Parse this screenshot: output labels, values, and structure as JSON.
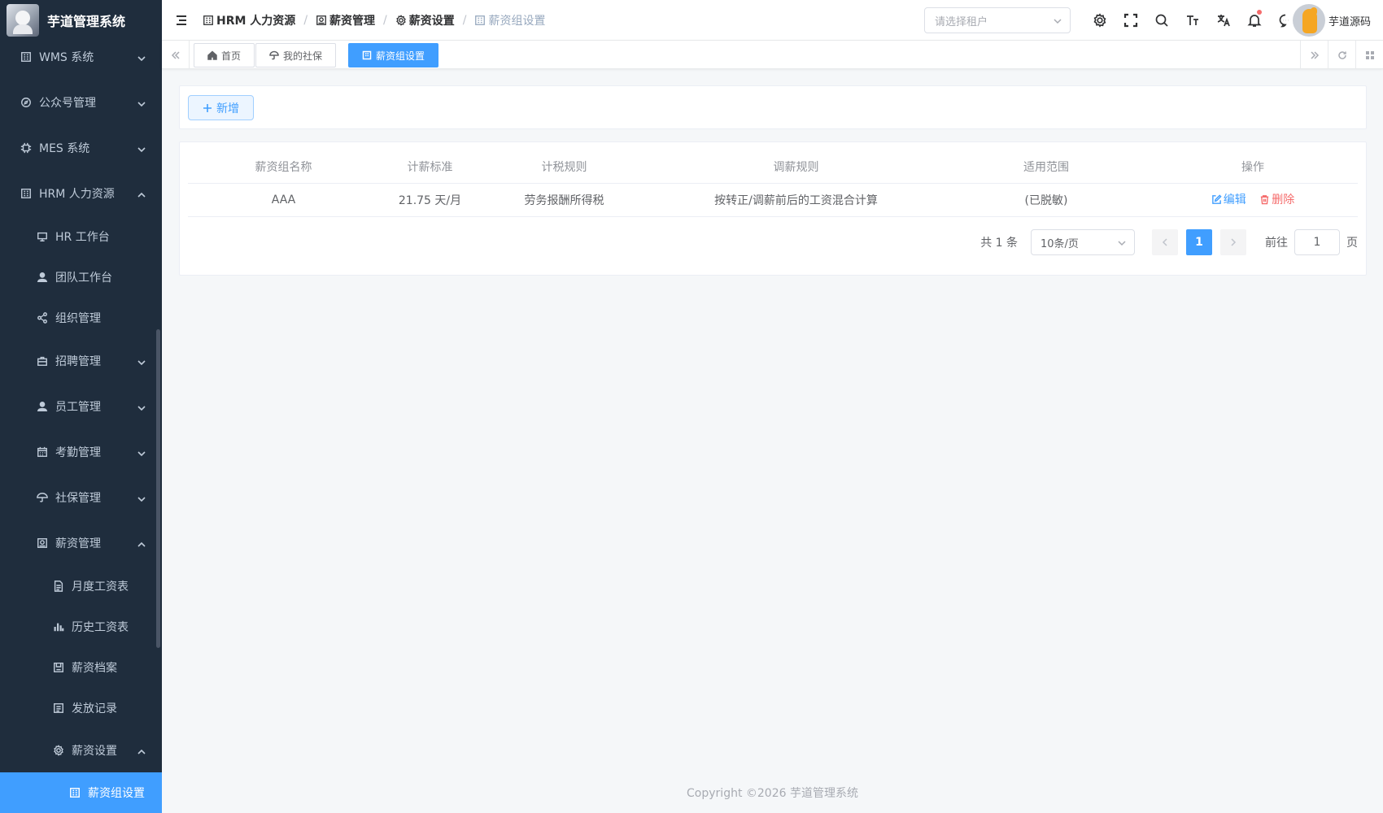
{
  "app": {
    "title": "芋道管理系统"
  },
  "sidebar": {
    "items": [
      {
        "label": "WMS 系统",
        "icon": "building-icon",
        "level": 1,
        "arrow": "down"
      },
      {
        "label": "公众号管理",
        "icon": "compass-icon",
        "level": 1,
        "arrow": "down"
      },
      {
        "label": "MES 系统",
        "icon": "cpu-icon",
        "level": 1,
        "arrow": "down"
      },
      {
        "label": "HRM 人力资源",
        "icon": "building-icon",
        "level": 1,
        "arrow": "up"
      },
      {
        "label": "HR 工作台",
        "icon": "monitor-icon",
        "level": 2
      },
      {
        "label": "团队工作台",
        "icon": "user-icon",
        "level": 2
      },
      {
        "label": "组织管理",
        "icon": "share-icon",
        "level": 2
      },
      {
        "label": "招聘管理",
        "icon": "briefcase-icon",
        "level": 2,
        "arrow": "down"
      },
      {
        "label": "员工管理",
        "icon": "user-icon",
        "level": 2,
        "arrow": "down"
      },
      {
        "label": "考勤管理",
        "icon": "calendar-icon",
        "level": 2,
        "arrow": "down"
      },
      {
        "label": "社保管理",
        "icon": "umbrella-icon",
        "level": 2,
        "arrow": "down"
      },
      {
        "label": "薪资管理",
        "icon": "money-icon",
        "level": 2,
        "arrow": "up"
      },
      {
        "label": "月度工资表",
        "icon": "document-icon",
        "level": 3
      },
      {
        "label": "历史工资表",
        "icon": "bar-chart-icon",
        "level": 3
      },
      {
        "label": "薪资档案",
        "icon": "archive-icon",
        "level": 3
      },
      {
        "label": "发放记录",
        "icon": "list-icon",
        "level": 3
      },
      {
        "label": "薪资设置",
        "icon": "gear-icon",
        "level": 3,
        "arrow": "up"
      },
      {
        "label": "薪资组设置",
        "icon": "building-icon",
        "level": 4,
        "active": true
      }
    ]
  },
  "header": {
    "breadcrumb": [
      "HRM 人力资源",
      "薪资管理",
      "薪资设置",
      "薪资组设置"
    ],
    "tenant_placeholder": "请选择租户",
    "username": "芋道源码"
  },
  "tags": [
    {
      "label": "首页",
      "icon": "home-icon",
      "active": false
    },
    {
      "label": "我的社保",
      "icon": "umbrella-icon",
      "active": false
    },
    {
      "label": "薪资组设置",
      "icon": "building-icon",
      "active": true
    }
  ],
  "toolbar": {
    "add_label": "新增"
  },
  "table": {
    "columns": [
      "薪资组名称",
      "计薪标准",
      "计税规则",
      "调薪规则",
      "适用范围",
      "操作"
    ],
    "rows": [
      {
        "name": "AAA",
        "standard": "21.75 天/月",
        "tax_rule": "劳务报酬所得税",
        "adjust_rule": "按转正/调薪前后的工资混合计算",
        "scope": "(已脱敏)",
        "edit": "编辑",
        "delete": "删除"
      }
    ]
  },
  "pagination": {
    "total": "共 1 条",
    "page_size": "10条/页",
    "current_page": "1",
    "goto_label": "前往",
    "goto_value": "1",
    "page_suffix": "页"
  },
  "footer": {
    "copyright": "Copyright ©2026 芋道管理系统"
  },
  "colors": {
    "primary": "#409eff",
    "sidebar_bg": "#1f2d3d",
    "danger": "#f56c6c"
  }
}
